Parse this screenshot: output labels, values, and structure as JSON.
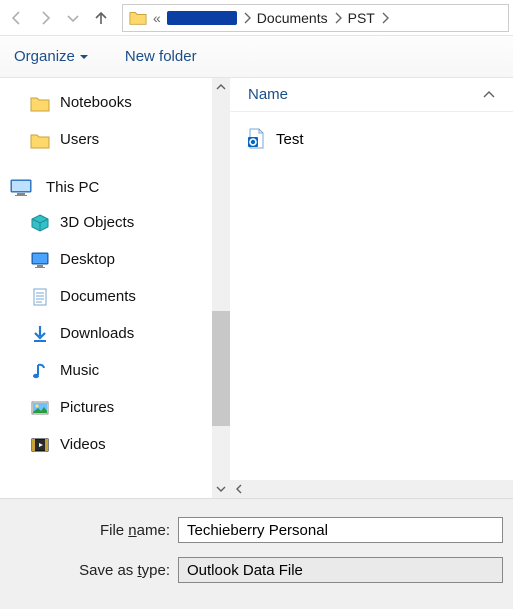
{
  "nav": {
    "back_enabled": false,
    "forward_enabled": false,
    "recent_enabled": false,
    "up_enabled": true
  },
  "address": {
    "ellipsis": "«",
    "crumbs": [
      "Documents",
      "PST"
    ]
  },
  "toolbar": {
    "organize": "Organize",
    "new_folder": "New folder"
  },
  "tree": {
    "items": [
      {
        "icon": "folder",
        "label": "Notebooks",
        "indent": 1
      },
      {
        "icon": "folder",
        "label": "Users",
        "indent": 1
      },
      {
        "icon": "this-pc",
        "label": "This PC",
        "indent": 0,
        "top": true
      },
      {
        "icon": "3d-objects",
        "label": "3D Objects",
        "indent": 1
      },
      {
        "icon": "desktop",
        "label": "Desktop",
        "indent": 1
      },
      {
        "icon": "documents",
        "label": "Documents",
        "indent": 1
      },
      {
        "icon": "downloads",
        "label": "Downloads",
        "indent": 1
      },
      {
        "icon": "music",
        "label": "Music",
        "indent": 1
      },
      {
        "icon": "pictures",
        "label": "Pictures",
        "indent": 1
      },
      {
        "icon": "videos",
        "label": "Videos",
        "indent": 1
      }
    ]
  },
  "content": {
    "header": {
      "name": "Name"
    },
    "files": [
      {
        "icon": "outlook-data",
        "label": "Test"
      }
    ]
  },
  "form": {
    "filename_label_pre": "File ",
    "filename_label_u": "n",
    "filename_label_post": "ame:",
    "filename_value": "Techieberry Personal",
    "savetype_label_pre": "Save as ",
    "savetype_label_u": "t",
    "savetype_label_post": "ype:",
    "savetype_value": "Outlook Data File"
  }
}
